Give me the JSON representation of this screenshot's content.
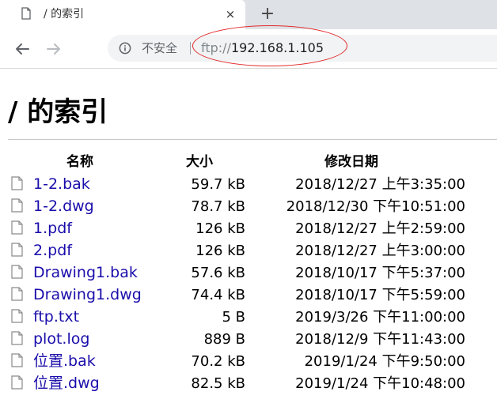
{
  "tab": {
    "title": "/ 的索引",
    "close": "×"
  },
  "newtab": {
    "label": "+"
  },
  "omnibox": {
    "security_label": "不安全",
    "url_scheme": "ftp://",
    "url_host": "192.168.1.105"
  },
  "annotation_color": "#e32b2b",
  "page": {
    "title": "/ 的索引"
  },
  "columns": {
    "name": "名称",
    "size": "大小",
    "modified": "修改日期"
  },
  "files": [
    {
      "name": "1-2.bak",
      "size": "59.7 kB",
      "modified": "2018/12/27 上午3:35:00"
    },
    {
      "name": "1-2.dwg",
      "size": "78.7 kB",
      "modified": "2018/12/30 下午10:51:00"
    },
    {
      "name": "1.pdf",
      "size": "126 kB",
      "modified": "2018/12/27 上午2:59:00"
    },
    {
      "name": "2.pdf",
      "size": "126 kB",
      "modified": "2018/12/27 上午3:00:00"
    },
    {
      "name": "Drawing1.bak",
      "size": "57.6 kB",
      "modified": "2018/10/17 下午5:37:00"
    },
    {
      "name": "Drawing1.dwg",
      "size": "74.4 kB",
      "modified": "2018/10/17 下午5:59:00"
    },
    {
      "name": "ftp.txt",
      "size": "5 B",
      "modified": "2019/3/26 下午11:00:00"
    },
    {
      "name": "plot.log",
      "size": "889 B",
      "modified": "2018/12/9 下午11:43:00"
    },
    {
      "name": "位置.bak",
      "size": "70.2 kB",
      "modified": "2019/1/24 下午9:50:00"
    },
    {
      "name": "位置.dwg",
      "size": "82.5 kB",
      "modified": "2019/1/24 下午10:48:00"
    }
  ]
}
